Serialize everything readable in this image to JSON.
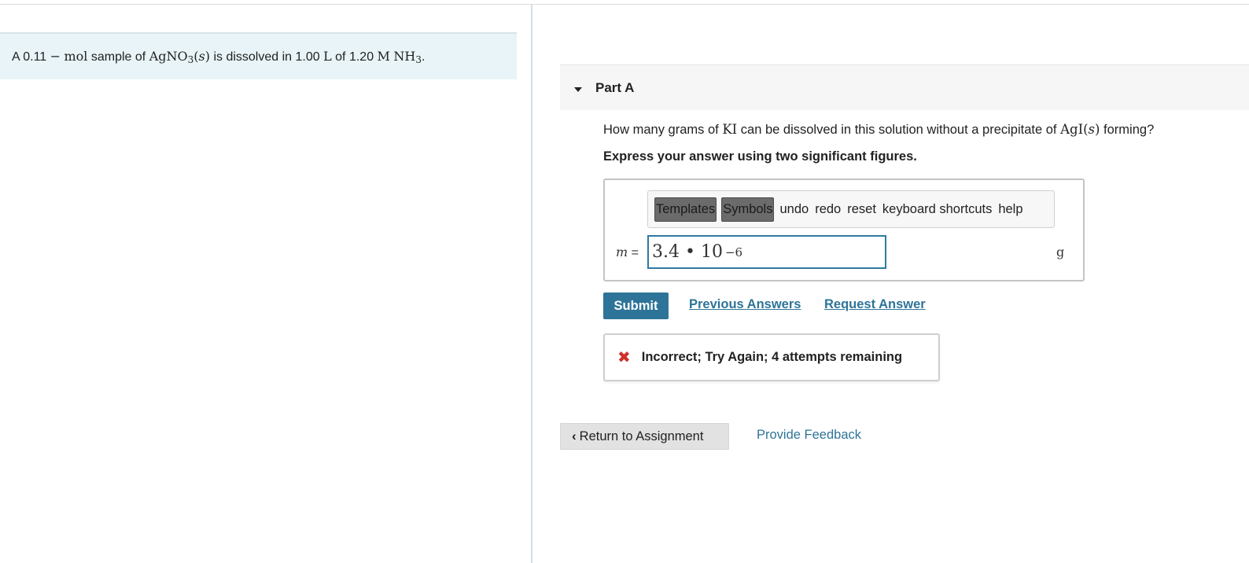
{
  "intro": {
    "a": "A 0.11",
    "dash": "−",
    "mol": "mol",
    "sample_of": "sample of",
    "agno3": "AgNO",
    "agno3_sub": "3",
    "state_open": "(",
    "state_s": "s",
    "state_close": ")",
    "dissolved_in": "is dissolved in 1.00",
    "liter": "L",
    "of": "of 1.20",
    "molar": "M",
    "nh3": "NH",
    "nh3_sub": "3",
    "period": "."
  },
  "part": {
    "title": "Part A"
  },
  "question": {
    "before": "How many grams of",
    "ki": "KI",
    "middle": "can be dissolved in this solution without a precipitate of",
    "agi": "AgI(",
    "agi_s": "s",
    "agi_close": ")",
    "after": "forming?"
  },
  "instruction": "Express your answer using two significant figures.",
  "toolbar": {
    "templates": "Templates",
    "symbols": "Symbols",
    "undo": "undo",
    "redo": "redo",
    "reset": "reset",
    "shortcuts": "keyboard shortcuts",
    "help": "help"
  },
  "answer": {
    "variable": "m",
    "equals": "=",
    "mantissa": "3.4 • 10",
    "exponent": "−6",
    "unit": "g"
  },
  "actions": {
    "submit": "Submit",
    "previous": "Previous Answers",
    "request": "Request Answer"
  },
  "feedback": {
    "icon": "✖",
    "text": "Incorrect; Try Again; 4 attempts remaining"
  },
  "footer": {
    "return": "Return to Assignment",
    "provide_feedback": "Provide Feedback"
  },
  "colors": {
    "accent": "#2e7498",
    "error": "#d0302b",
    "intro_bg": "#e8f4f7"
  }
}
